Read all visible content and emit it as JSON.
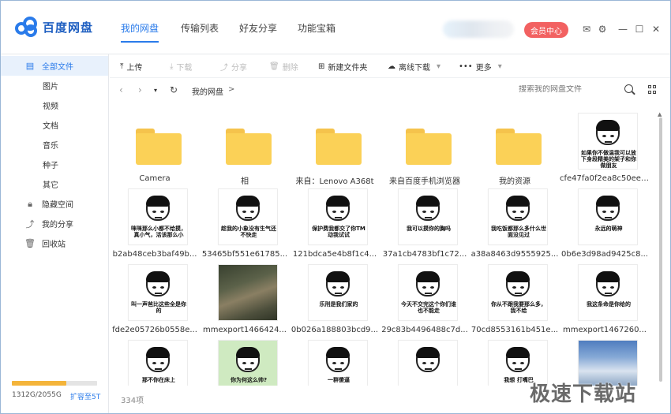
{
  "app": {
    "name": "百度网盘",
    "vip_button": "会员中心",
    "colors": {
      "accent": "#2a7bea",
      "vip": "#f26161",
      "folder": "#fbd157",
      "quota": "#f4b43a"
    }
  },
  "nav_tabs": [
    {
      "label": "我的网盘",
      "active": true
    },
    {
      "label": "传输列表",
      "active": false
    },
    {
      "label": "好友分享",
      "active": false
    },
    {
      "label": "功能宝箱",
      "active": false
    }
  ],
  "sidebar": {
    "items": [
      {
        "label": "全部文件",
        "icon": "file-icon",
        "active": true
      },
      {
        "label": "图片"
      },
      {
        "label": "视频"
      },
      {
        "label": "文档"
      },
      {
        "label": "音乐"
      },
      {
        "label": "种子"
      },
      {
        "label": "其它"
      },
      {
        "label": "隐藏空间",
        "icon": "lock-icon"
      },
      {
        "label": "我的分享",
        "icon": "share-icon"
      },
      {
        "label": "回收站",
        "icon": "trash-icon"
      }
    ],
    "quota": {
      "text": "1312G/2055G",
      "used": 1312,
      "total": 2055,
      "upgrade": "扩容至5T"
    }
  },
  "toolbar": {
    "upload": "上传",
    "download": "下载",
    "share": "分享",
    "delete": "删除",
    "new_folder": "新建文件夹",
    "offline": "离线下载",
    "more": "更多"
  },
  "address": {
    "breadcrumb": "我的网盘",
    "sep": ">",
    "search_placeholder": "搜索我的网盘文件"
  },
  "files": [
    {
      "name": "Camera",
      "type": "folder"
    },
    {
      "name": "相",
      "type": "folder"
    },
    {
      "name": "来自：Lenovo A368t",
      "type": "folder"
    },
    {
      "name": "来自百度手机浏览器",
      "type": "folder"
    },
    {
      "name": "我的资源",
      "type": "folder"
    },
    {
      "name": "cfe47fa0f2ea8c50eec...",
      "type": "image",
      "caption": "如果你不做温我可以放下身段精美的架子和你做朋友"
    },
    {
      "name": "b2ab48ceb3baf49b...",
      "type": "image",
      "caption": "咪咪那么小都不给摸，真小气，活该那么小"
    },
    {
      "name": "53465bf551e61785...",
      "type": "image",
      "caption": "趁我的小象没有生气还不快走"
    },
    {
      "name": "121bdca5e4b8f1c4...",
      "type": "image",
      "caption": "保护费我都交了你TM动我试试"
    },
    {
      "name": "37a1cb4783bf1c72...",
      "type": "image",
      "caption": "我可以摸你的胸吗"
    },
    {
      "name": "a38a8463d9555925...",
      "type": "image",
      "caption": "我吃饭都那么多什么世面没见过"
    },
    {
      "name": "0b6e3d98ad9425c8...",
      "type": "image",
      "caption": "永远的萌神"
    },
    {
      "name": "fde2e05726b0558e...",
      "type": "image",
      "caption": "叫一声爸比这些全是你的"
    },
    {
      "name": "mmexport1466424...",
      "type": "photo-forest"
    },
    {
      "name": "0b026a188803bcd9...",
      "type": "image",
      "caption": "乐刑是我们家的"
    },
    {
      "name": "29c83b4496488c7d...",
      "type": "image",
      "caption": "今天不交完这个你们谁也不能走"
    },
    {
      "name": "70cd8553161b451e...",
      "type": "image",
      "caption": "你从不跟我要那么多，我不给"
    },
    {
      "name": "mmexport1467260...",
      "type": "image",
      "caption": "我这条命是你给的"
    },
    {
      "name": "",
      "type": "image",
      "caption": "那不你在床上"
    },
    {
      "name": "",
      "type": "photo-green",
      "caption": "你为何这么帅?"
    },
    {
      "name": "",
      "type": "image",
      "caption": "一群傻逼"
    },
    {
      "name": "",
      "type": "image",
      "caption": ""
    },
    {
      "name": "",
      "type": "image",
      "caption": "我想 打嘴巴"
    },
    {
      "name": "",
      "type": "photo-sky"
    }
  ],
  "status": {
    "count": "334项"
  },
  "watermark": "极速下载站"
}
